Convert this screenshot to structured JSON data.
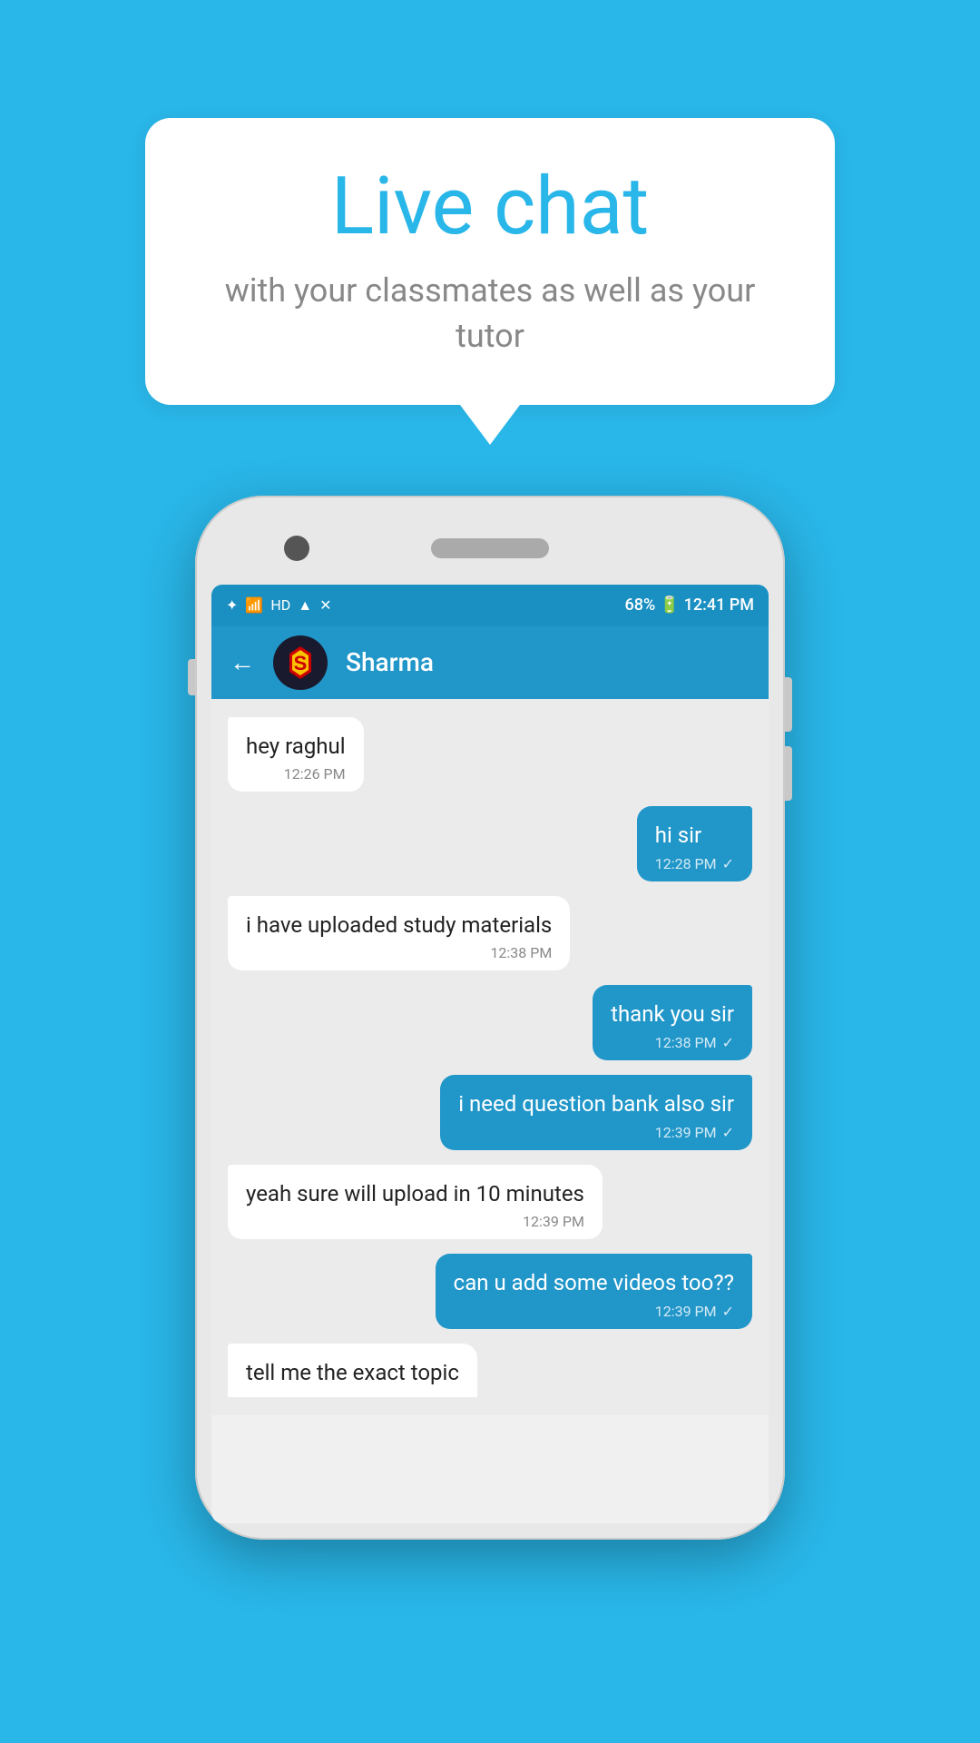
{
  "background_color": "#29b6e8",
  "bubble": {
    "title": "Live chat",
    "subtitle": "with your classmates as well as your tutor"
  },
  "phone": {
    "status_bar": {
      "time": "12:41 PM",
      "battery": "68%",
      "icons": "bluetooth signal hd wifi network"
    },
    "chat_header": {
      "contact_name": "Sharma",
      "back_label": "←"
    },
    "messages": [
      {
        "id": "msg1",
        "type": "received",
        "text": "hey raghul",
        "time": "12:26 PM",
        "tick": ""
      },
      {
        "id": "msg2",
        "type": "sent",
        "text": "hi sir",
        "time": "12:28 PM",
        "tick": "✓"
      },
      {
        "id": "msg3",
        "type": "received",
        "text": "i have uploaded study materials",
        "time": "12:38 PM",
        "tick": ""
      },
      {
        "id": "msg4",
        "type": "sent",
        "text": "thank you sir",
        "time": "12:38 PM",
        "tick": "✓"
      },
      {
        "id": "msg5",
        "type": "sent",
        "text": "i need question bank also sir",
        "time": "12:39 PM",
        "tick": "✓"
      },
      {
        "id": "msg6",
        "type": "received",
        "text": "yeah sure will upload in 10 minutes",
        "time": "12:39 PM",
        "tick": ""
      },
      {
        "id": "msg7",
        "type": "sent",
        "text": "can u add some videos too??",
        "time": "12:39 PM",
        "tick": "✓"
      },
      {
        "id": "msg8",
        "type": "received",
        "text": "tell me the exact topic",
        "time": "",
        "tick": "",
        "cutoff": true
      }
    ]
  }
}
